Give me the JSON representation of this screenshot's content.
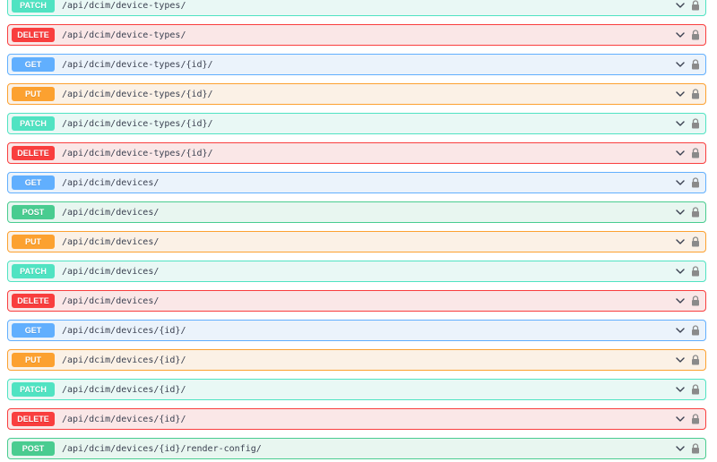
{
  "operations": [
    {
      "method": "PATCH",
      "path": "/api/dcim/device-types/"
    },
    {
      "method": "DELETE",
      "path": "/api/dcim/device-types/"
    },
    {
      "method": "GET",
      "path": "/api/dcim/device-types/{id}/"
    },
    {
      "method": "PUT",
      "path": "/api/dcim/device-types/{id}/"
    },
    {
      "method": "PATCH",
      "path": "/api/dcim/device-types/{id}/"
    },
    {
      "method": "DELETE",
      "path": "/api/dcim/device-types/{id}/"
    },
    {
      "method": "GET",
      "path": "/api/dcim/devices/"
    },
    {
      "method": "POST",
      "path": "/api/dcim/devices/"
    },
    {
      "method": "PUT",
      "path": "/api/dcim/devices/"
    },
    {
      "method": "PATCH",
      "path": "/api/dcim/devices/"
    },
    {
      "method": "DELETE",
      "path": "/api/dcim/devices/"
    },
    {
      "method": "GET",
      "path": "/api/dcim/devices/{id}/"
    },
    {
      "method": "PUT",
      "path": "/api/dcim/devices/{id}/"
    },
    {
      "method": "PATCH",
      "path": "/api/dcim/devices/{id}/"
    },
    {
      "method": "DELETE",
      "path": "/api/dcim/devices/{id}/"
    },
    {
      "method": "POST",
      "path": "/api/dcim/devices/{id}/render-config/"
    }
  ],
  "icons": {
    "expand": "chevron-down-icon",
    "auth": "lock-icon"
  },
  "colors": {
    "get": "#61affe",
    "put": "#fca130",
    "patch": "#50e3c2",
    "delete": "#f93e3e",
    "post": "#49cc90"
  }
}
